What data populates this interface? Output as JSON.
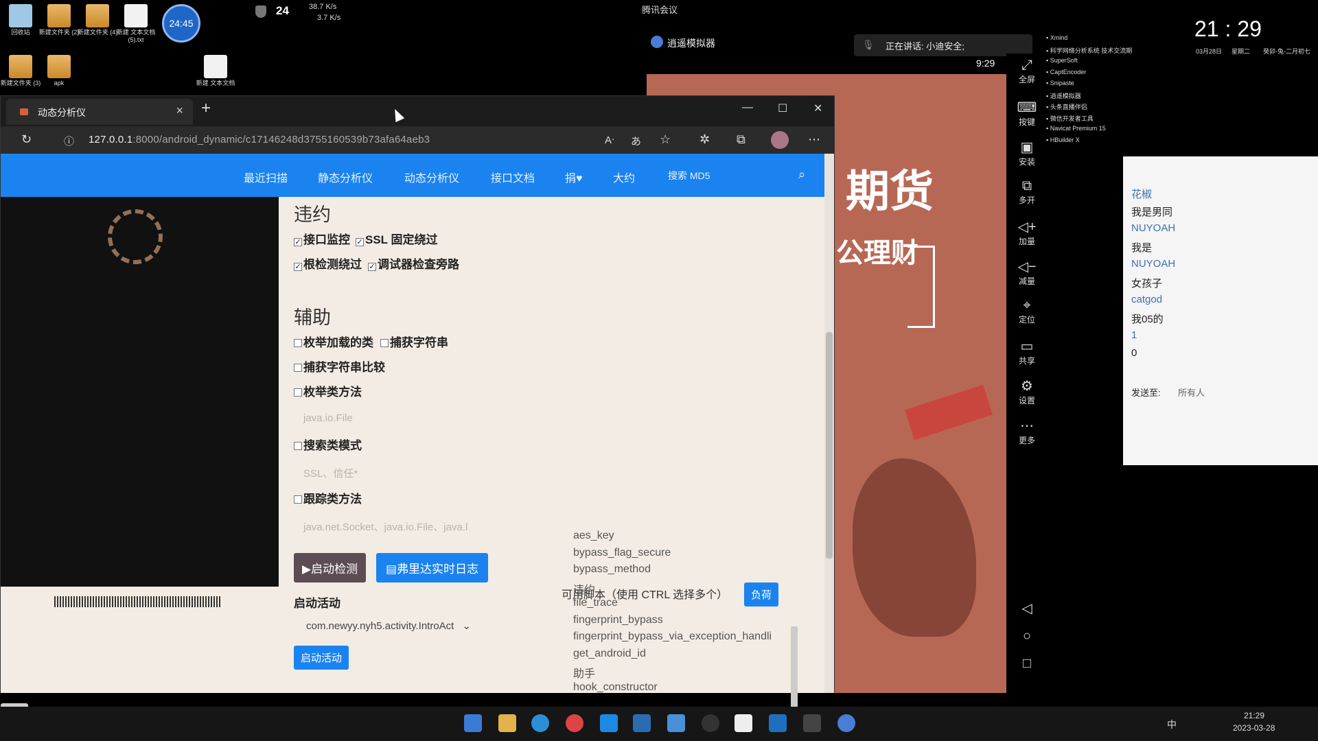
{
  "desktop": {
    "icons": [
      {
        "label": "回收站"
      },
      {
        "label": "新建文件夹 (2)"
      },
      {
        "label": "新建文件夹 (4)"
      },
      {
        "label": "新建 文本文档 (5).txt"
      },
      {
        "label": "新建文件夹 (3)"
      },
      {
        "label": "apk"
      },
      {
        "label": "新建 文本文档"
      }
    ],
    "badge_time": "24:45"
  },
  "topbar": {
    "cpu": "24",
    "net_up": "38.7 K/s",
    "net_down": "3.7 K/s",
    "meeting": "腾讯会议",
    "emulator_title": "逍遥模拟器",
    "speaking": "正在讲话: 小迪安全;",
    "phone_time": "9:29"
  },
  "browser": {
    "tab_title": "动态分析仪",
    "url_host": "127.0.0.1",
    "url_rest": ":8000/android_dynamic/c17146248d3755160539b73afa64aeb3"
  },
  "nav": {
    "items": [
      "最近扫描",
      "静态分析仪",
      "动态分析仪",
      "接口文档",
      "捐♥",
      "大约",
      "搜索 MD5"
    ]
  },
  "content": {
    "section_bypass": "违约",
    "checks_bypass": [
      {
        "label": "接口监控",
        "checked": true
      },
      {
        "label": "SSL 固定绕过",
        "checked": true
      },
      {
        "label": "根检测绕过",
        "checked": true
      },
      {
        "label": "调试器检查旁路",
        "checked": true
      }
    ],
    "section_aux": "辅助",
    "checks_aux": [
      {
        "label": "枚举加载的类",
        "checked": false
      },
      {
        "label": "捕获字符串",
        "checked": false
      },
      {
        "label": "捕获字符串比较",
        "checked": false
      },
      {
        "label": "枚举类方法",
        "checked": false
      },
      {
        "label": "搜索类模式",
        "checked": false
      },
      {
        "label": "跟踪类方法",
        "checked": false
      }
    ],
    "placeholders": {
      "enum_methods": "java.io.File",
      "search_pattern": "SSL、信任*",
      "trace_methods": "java.net.Socket、java.io.File、java.l"
    },
    "btn_start_detect": "▶启动检测",
    "btn_realtime_log": "弗里达实时日志",
    "start_activity_label": "启动活动",
    "activity_value": "com.newyy.nyh5.activity.IntroAct",
    "btn_start_activity": "启动活动",
    "scripts_label": "可用脚本（使用 CTRL 选择多个）",
    "btn_load": "负荷",
    "scripts": [
      "aes_key",
      "bypass_flag_secure",
      "bypass_method",
      "违约",
      "file_trace",
      "fingerprint_bypass",
      "fingerprint_bypass_via_exception_handli",
      "get_android_id",
      "助手",
      "hook_constructor"
    ]
  },
  "emulator": {
    "promo1": "期货",
    "promo2": "公理财",
    "side": [
      "全屏",
      "按键",
      "安装",
      "多开",
      "加量",
      "减量",
      "定位",
      "共享",
      "设置",
      "更多"
    ]
  },
  "clock": {
    "time": "21 : 29",
    "date": "03月28日",
    "weekday": "星期二",
    "lunar": "癸卯-兔-二月初七"
  },
  "recent_apps": [
    "Xmind",
    "科学网络分析系统 技术交流期",
    "SuperSoft",
    "CaptEncoder",
    "Snipaste",
    "逍遥模拟器",
    "头条直播伴侣",
    "微信开发者工具",
    "Navicat Premium 15",
    "HBuilder X"
  ],
  "chat": {
    "messages": [
      {
        "name": "花椒",
        "text": "我是男同"
      },
      {
        "name": "NUYOAH",
        "text": "我是"
      },
      {
        "name": "NUYOAH",
        "text": "女孩子"
      },
      {
        "name": "catgod",
        "text": "我05的"
      },
      {
        "name": "",
        "text": "1"
      },
      {
        "name": "",
        "text": "0"
      }
    ],
    "send_to_label": "发送至:",
    "send_to_value": "所有人"
  },
  "taskbar": {
    "time": "21:29",
    "date": "2023-03-28",
    "ime": "中"
  }
}
